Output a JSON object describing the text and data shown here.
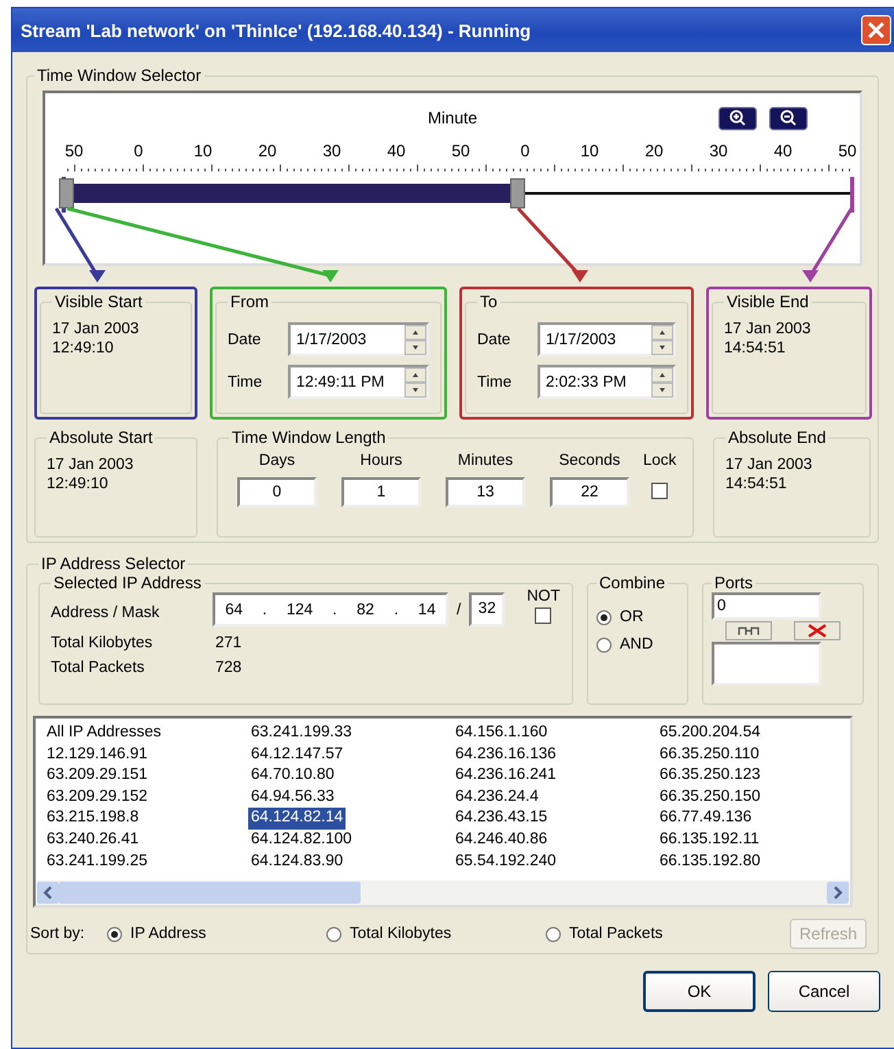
{
  "window": {
    "title": "Stream 'Lab network' on 'ThinIce' (192.168.40.134) - Running"
  },
  "time_window_selector": {
    "legend": "Time Window Selector",
    "axis_label": "Minute",
    "ticks": [
      "50",
      "0",
      "10",
      "20",
      "30",
      "40",
      "50",
      "0",
      "10",
      "20",
      "30",
      "40",
      "50"
    ],
    "range": {
      "level": 0.575
    },
    "visible_start": {
      "legend": "Visible Start",
      "color": "#3a3a9c",
      "date": "17 Jan 2003",
      "time": "12:49:10"
    },
    "from": {
      "legend": "From",
      "color": "#3cb43c",
      "date_label": "Date",
      "date": "1/17/2003",
      "time_label": "Time",
      "time": "12:49:11 PM"
    },
    "to": {
      "legend": "To",
      "color": "#b83434",
      "date_label": "Date",
      "date": "1/17/2003",
      "time_label": "Time",
      "time": "2:02:33 PM"
    },
    "visible_end": {
      "legend": "Visible End",
      "color": "#a040a0",
      "date": "17 Jan 2003",
      "time": "14:54:51"
    },
    "absolute_start": {
      "legend": "Absolute Start",
      "date": "17 Jan 2003",
      "time": "12:49:10"
    },
    "length": {
      "legend": "Time Window Length",
      "fields": [
        {
          "label": "Days",
          "value": "0"
        },
        {
          "label": "Hours",
          "value": "1"
        },
        {
          "label": "Minutes",
          "value": "13"
        },
        {
          "label": "Seconds",
          "value": "22"
        }
      ],
      "lock": {
        "label": "Lock",
        "checked": false
      }
    },
    "absolute_end": {
      "legend": "Absolute End",
      "date": "17 Jan 2003",
      "time": "14:54:51"
    }
  },
  "ip_selector": {
    "legend": "IP Address Selector",
    "selected": {
      "legend": "Selected IP Address",
      "address_label": "Address / Mask",
      "address_parts": [
        "64",
        ".",
        "124",
        ".",
        "82",
        ".",
        "14"
      ],
      "slash": "/",
      "mask": "32",
      "not": {
        "label": "NOT",
        "checked": false
      },
      "stats": [
        {
          "label": "Total Kilobytes",
          "value": "271"
        },
        {
          "label": "Total Packets",
          "value": "728"
        }
      ]
    },
    "combine": {
      "legend": "Combine",
      "options": [
        {
          "label": "OR",
          "selected": true
        },
        {
          "label": "AND",
          "selected": false
        }
      ]
    },
    "ports": {
      "legend": "Ports",
      "value": "0"
    },
    "addresses": [
      {
        "label": "All IP Addresses",
        "selected": false
      },
      {
        "label": "12.129.146.91",
        "selected": false
      },
      {
        "label": "63.209.29.151",
        "selected": false
      },
      {
        "label": "63.209.29.152",
        "selected": false
      },
      {
        "label": "63.215.198.8",
        "selected": false
      },
      {
        "label": "63.240.26.41",
        "selected": false
      },
      {
        "label": "63.241.199.25",
        "selected": false
      },
      {
        "label": "63.241.199.33",
        "selected": false
      },
      {
        "label": "64.12.147.57",
        "selected": false
      },
      {
        "label": "64.70.10.80",
        "selected": false
      },
      {
        "label": "64.94.56.33",
        "selected": false
      },
      {
        "label": "64.124.82.14",
        "selected": true
      },
      {
        "label": "64.124.82.100",
        "selected": false
      },
      {
        "label": "64.124.83.90",
        "selected": false
      },
      {
        "label": "64.156.1.160",
        "selected": false
      },
      {
        "label": "64.236.16.136",
        "selected": false
      },
      {
        "label": "64.236.16.241",
        "selected": false
      },
      {
        "label": "64.236.24.4",
        "selected": false
      },
      {
        "label": "64.236.43.15",
        "selected": false
      },
      {
        "label": "64.246.40.86",
        "selected": false
      },
      {
        "label": "65.54.192.240",
        "selected": false
      },
      {
        "label": "65.200.204.54",
        "selected": false
      },
      {
        "label": "66.35.250.110",
        "selected": false
      },
      {
        "label": "66.35.250.123",
        "selected": false
      },
      {
        "label": "66.35.250.150",
        "selected": false
      },
      {
        "label": "66.77.49.136",
        "selected": false
      },
      {
        "label": "66.135.192.11",
        "selected": false
      },
      {
        "label": "66.135.192.80",
        "selected": false
      }
    ],
    "sort": {
      "label": "Sort by:",
      "options": [
        {
          "label": "IP Address",
          "selected": true
        },
        {
          "label": "Total Kilobytes",
          "selected": false
        },
        {
          "label": "Total Packets",
          "selected": false
        }
      ]
    },
    "refresh": {
      "label": "Refresh",
      "disabled": true
    }
  },
  "buttons": [
    {
      "label": "OK",
      "default": true
    },
    {
      "label": "Cancel",
      "default": false
    }
  ]
}
